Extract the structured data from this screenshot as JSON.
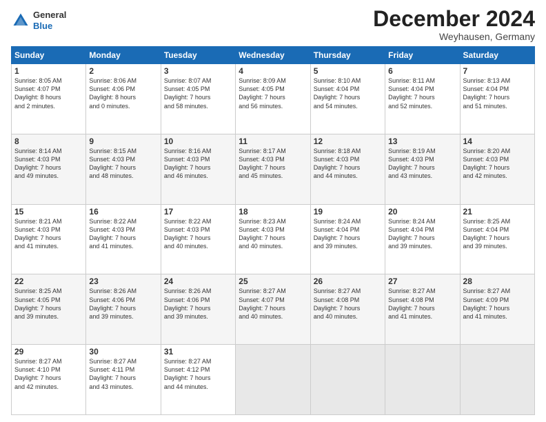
{
  "logo": {
    "line1": "General",
    "line2": "Blue"
  },
  "title": "December 2024",
  "location": "Weyhausen, Germany",
  "days_header": [
    "Sunday",
    "Monday",
    "Tuesday",
    "Wednesday",
    "Thursday",
    "Friday",
    "Saturday"
  ],
  "weeks": [
    [
      {
        "day": 1,
        "lines": [
          "Sunrise: 8:05 AM",
          "Sunset: 4:07 PM",
          "Daylight: 8 hours",
          "and 2 minutes."
        ]
      },
      {
        "day": 2,
        "lines": [
          "Sunrise: 8:06 AM",
          "Sunset: 4:06 PM",
          "Daylight: 8 hours",
          "and 0 minutes."
        ]
      },
      {
        "day": 3,
        "lines": [
          "Sunrise: 8:07 AM",
          "Sunset: 4:05 PM",
          "Daylight: 7 hours",
          "and 58 minutes."
        ]
      },
      {
        "day": 4,
        "lines": [
          "Sunrise: 8:09 AM",
          "Sunset: 4:05 PM",
          "Daylight: 7 hours",
          "and 56 minutes."
        ]
      },
      {
        "day": 5,
        "lines": [
          "Sunrise: 8:10 AM",
          "Sunset: 4:04 PM",
          "Daylight: 7 hours",
          "and 54 minutes."
        ]
      },
      {
        "day": 6,
        "lines": [
          "Sunrise: 8:11 AM",
          "Sunset: 4:04 PM",
          "Daylight: 7 hours",
          "and 52 minutes."
        ]
      },
      {
        "day": 7,
        "lines": [
          "Sunrise: 8:13 AM",
          "Sunset: 4:04 PM",
          "Daylight: 7 hours",
          "and 51 minutes."
        ]
      }
    ],
    [
      {
        "day": 8,
        "lines": [
          "Sunrise: 8:14 AM",
          "Sunset: 4:03 PM",
          "Daylight: 7 hours",
          "and 49 minutes."
        ]
      },
      {
        "day": 9,
        "lines": [
          "Sunrise: 8:15 AM",
          "Sunset: 4:03 PM",
          "Daylight: 7 hours",
          "and 48 minutes."
        ]
      },
      {
        "day": 10,
        "lines": [
          "Sunrise: 8:16 AM",
          "Sunset: 4:03 PM",
          "Daylight: 7 hours",
          "and 46 minutes."
        ]
      },
      {
        "day": 11,
        "lines": [
          "Sunrise: 8:17 AM",
          "Sunset: 4:03 PM",
          "Daylight: 7 hours",
          "and 45 minutes."
        ]
      },
      {
        "day": 12,
        "lines": [
          "Sunrise: 8:18 AM",
          "Sunset: 4:03 PM",
          "Daylight: 7 hours",
          "and 44 minutes."
        ]
      },
      {
        "day": 13,
        "lines": [
          "Sunrise: 8:19 AM",
          "Sunset: 4:03 PM",
          "Daylight: 7 hours",
          "and 43 minutes."
        ]
      },
      {
        "day": 14,
        "lines": [
          "Sunrise: 8:20 AM",
          "Sunset: 4:03 PM",
          "Daylight: 7 hours",
          "and 42 minutes."
        ]
      }
    ],
    [
      {
        "day": 15,
        "lines": [
          "Sunrise: 8:21 AM",
          "Sunset: 4:03 PM",
          "Daylight: 7 hours",
          "and 41 minutes."
        ]
      },
      {
        "day": 16,
        "lines": [
          "Sunrise: 8:22 AM",
          "Sunset: 4:03 PM",
          "Daylight: 7 hours",
          "and 41 minutes."
        ]
      },
      {
        "day": 17,
        "lines": [
          "Sunrise: 8:22 AM",
          "Sunset: 4:03 PM",
          "Daylight: 7 hours",
          "and 40 minutes."
        ]
      },
      {
        "day": 18,
        "lines": [
          "Sunrise: 8:23 AM",
          "Sunset: 4:03 PM",
          "Daylight: 7 hours",
          "and 40 minutes."
        ]
      },
      {
        "day": 19,
        "lines": [
          "Sunrise: 8:24 AM",
          "Sunset: 4:04 PM",
          "Daylight: 7 hours",
          "and 39 minutes."
        ]
      },
      {
        "day": 20,
        "lines": [
          "Sunrise: 8:24 AM",
          "Sunset: 4:04 PM",
          "Daylight: 7 hours",
          "and 39 minutes."
        ]
      },
      {
        "day": 21,
        "lines": [
          "Sunrise: 8:25 AM",
          "Sunset: 4:04 PM",
          "Daylight: 7 hours",
          "and 39 minutes."
        ]
      }
    ],
    [
      {
        "day": 22,
        "lines": [
          "Sunrise: 8:25 AM",
          "Sunset: 4:05 PM",
          "Daylight: 7 hours",
          "and 39 minutes."
        ]
      },
      {
        "day": 23,
        "lines": [
          "Sunrise: 8:26 AM",
          "Sunset: 4:06 PM",
          "Daylight: 7 hours",
          "and 39 minutes."
        ]
      },
      {
        "day": 24,
        "lines": [
          "Sunrise: 8:26 AM",
          "Sunset: 4:06 PM",
          "Daylight: 7 hours",
          "and 39 minutes."
        ]
      },
      {
        "day": 25,
        "lines": [
          "Sunrise: 8:27 AM",
          "Sunset: 4:07 PM",
          "Daylight: 7 hours",
          "and 40 minutes."
        ]
      },
      {
        "day": 26,
        "lines": [
          "Sunrise: 8:27 AM",
          "Sunset: 4:08 PM",
          "Daylight: 7 hours",
          "and 40 minutes."
        ]
      },
      {
        "day": 27,
        "lines": [
          "Sunrise: 8:27 AM",
          "Sunset: 4:08 PM",
          "Daylight: 7 hours",
          "and 41 minutes."
        ]
      },
      {
        "day": 28,
        "lines": [
          "Sunrise: 8:27 AM",
          "Sunset: 4:09 PM",
          "Daylight: 7 hours",
          "and 41 minutes."
        ]
      }
    ],
    [
      {
        "day": 29,
        "lines": [
          "Sunrise: 8:27 AM",
          "Sunset: 4:10 PM",
          "Daylight: 7 hours",
          "and 42 minutes."
        ]
      },
      {
        "day": 30,
        "lines": [
          "Sunrise: 8:27 AM",
          "Sunset: 4:11 PM",
          "Daylight: 7 hours",
          "and 43 minutes."
        ]
      },
      {
        "day": 31,
        "lines": [
          "Sunrise: 8:27 AM",
          "Sunset: 4:12 PM",
          "Daylight: 7 hours",
          "and 44 minutes."
        ]
      },
      null,
      null,
      null,
      null
    ]
  ]
}
